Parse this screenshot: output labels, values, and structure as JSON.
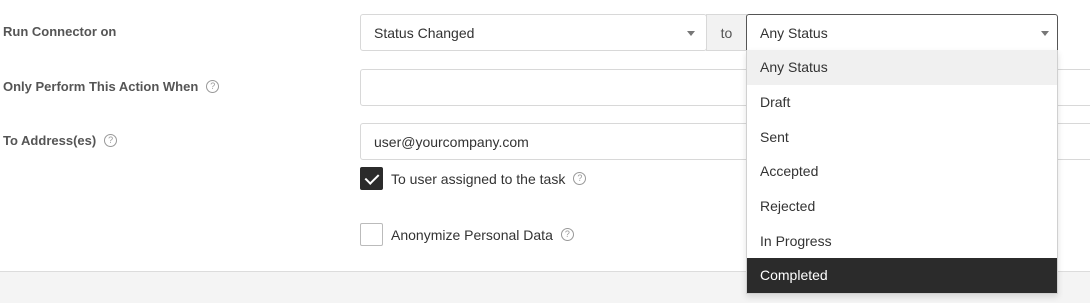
{
  "form": {
    "run_connector": {
      "label": "Run Connector on",
      "event_value": "Status Changed",
      "to_label": "to",
      "status_value": "Any Status"
    },
    "only_perform": {
      "label": "Only Perform This Action When",
      "help_icon": "question-circle-icon",
      "value": ""
    },
    "to_address": {
      "label": "To Address(es)",
      "help_icon": "question-circle-icon",
      "value": "user@yourcompany.com"
    },
    "assigned_checkbox": {
      "label": "To user assigned to the task",
      "checked": true
    },
    "anonymize_checkbox": {
      "label": "Anonymize Personal Data",
      "checked": false
    }
  },
  "status_dropdown": {
    "options": [
      "Any Status",
      "Draft",
      "Sent",
      "Accepted",
      "Rejected",
      "In Progress",
      "Completed"
    ],
    "hovered": "Any Status",
    "highlighted": "Completed"
  },
  "colors": {
    "dark": "#2b2b2b",
    "border": "#d8d8d8",
    "label": "#555555"
  }
}
